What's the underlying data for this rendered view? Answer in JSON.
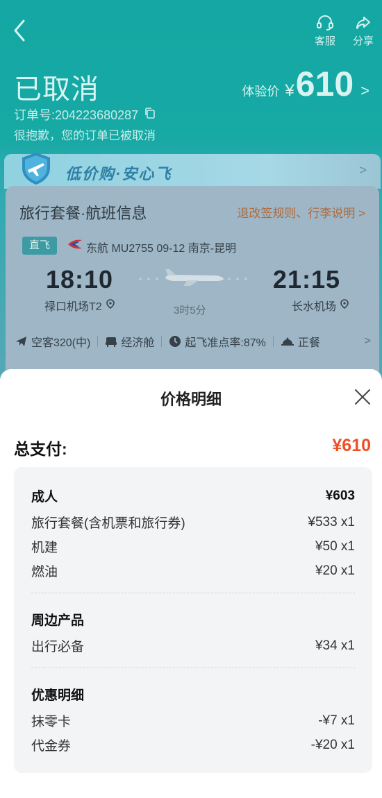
{
  "header": {
    "actions": [
      {
        "label": "客服",
        "icon": "headset-icon"
      },
      {
        "label": "分享",
        "icon": "share-icon"
      }
    ],
    "status": "已取消",
    "price_label": "体验价",
    "price_currency": "¥",
    "price_value": "610",
    "order_number": "订单号:204223680287",
    "cancel_message": "很抱歉，您的订单已被取消"
  },
  "promo": {
    "text": "低价购·安心飞"
  },
  "flight": {
    "section_title": "旅行套餐·航班信息",
    "rules_link": "退改签规则、行李说明",
    "direct_tag": "直飞",
    "airline_info": "东航 MU2755   09-12 南京-昆明",
    "departure_time": "18:10",
    "arrival_time": "21:15",
    "departure_airport": "禄口机场T2",
    "arrival_airport": "长水机场",
    "duration": "3时5分",
    "attributes": [
      {
        "label": "空客320(中)",
        "icon": "plane-icon"
      },
      {
        "label": "经济舱",
        "icon": "seat-icon"
      },
      {
        "label": "起飞准点率:87%",
        "icon": "clock-icon"
      },
      {
        "label": "正餐",
        "icon": "meal-icon"
      }
    ]
  },
  "sheet": {
    "title": "价格明细",
    "total_label": "总支付:",
    "total_value": "¥610",
    "sections": [
      {
        "name": "成人",
        "amount": "¥603",
        "items": [
          {
            "label": "旅行套餐(含机票和旅行券)",
            "value": "¥533 x1"
          },
          {
            "label": "机建",
            "value": "¥50 x1"
          },
          {
            "label": "燃油",
            "value": "¥20 x1"
          }
        ]
      },
      {
        "name": "周边产品",
        "amount": "",
        "items": [
          {
            "label": "出行必备",
            "value": "¥34 x1"
          }
        ]
      },
      {
        "name": "优惠明细",
        "amount": "",
        "items": [
          {
            "label": "抹零卡",
            "value": "-¥7 x1"
          },
          {
            "label": "代金券",
            "value": "-¥20 x1"
          }
        ]
      }
    ]
  },
  "colors": {
    "header_teal": "#17a9a4",
    "price_accent": "#ef4f24",
    "rules_orange": "#b06a3a"
  }
}
